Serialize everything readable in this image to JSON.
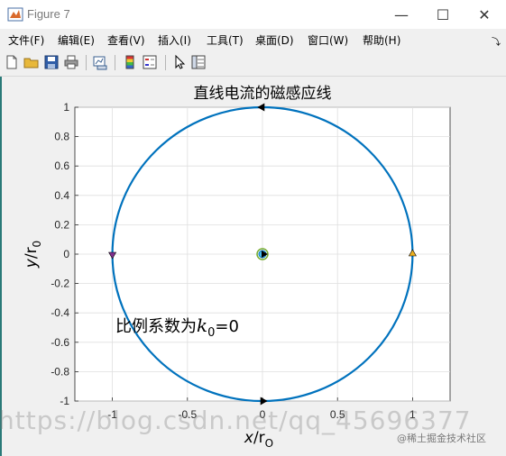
{
  "window": {
    "title": "Figure 7",
    "icon": "matlab-figure-icon",
    "controls": [
      "minimize-icon",
      "maximize-icon",
      "close-icon"
    ]
  },
  "menu": {
    "items": [
      {
        "label": "文件(F)"
      },
      {
        "label": "编辑(E)"
      },
      {
        "label": "查看(V)"
      },
      {
        "label": "插入(I)"
      },
      {
        "label": "工具(T)"
      },
      {
        "label": "桌面(D)"
      },
      {
        "label": "窗口(W)"
      },
      {
        "label": "帮助(H)"
      }
    ],
    "overflow_icon": "dock-arrow-icon"
  },
  "toolbar": {
    "buttons": [
      "new-figure-icon",
      "open-file-icon",
      "save-icon",
      "print-icon",
      "link-plot-icon",
      "colorbar-icon",
      "legend-icon",
      "pointer-icon",
      "property-editor-icon"
    ]
  },
  "chart_data": {
    "type": "line",
    "title": "直线电流的磁感应线",
    "xlabel": "x/r_O",
    "ylabel": "y/r_0",
    "xlim": [
      -1.25,
      1.25
    ],
    "ylim": [
      -1,
      1
    ],
    "xticks": [
      "-1",
      "-0.5",
      "0",
      "0.5",
      "1"
    ],
    "yticks": [
      "-1",
      "-0.8",
      "-0.6",
      "-0.4",
      "-0.2",
      "0",
      "0.2",
      "0.4",
      "0.6",
      "0.8",
      "1"
    ],
    "grid": true,
    "series": [
      {
        "shape": "circle",
        "center": [
          0,
          0
        ],
        "radius": 1,
        "color": "#0072bd"
      }
    ],
    "arrows": [
      {
        "x": 0,
        "y": 1,
        "direction": "left",
        "color": "#000000"
      },
      {
        "x": -1,
        "y": 0,
        "direction": "down",
        "color": "#7e2f8e"
      },
      {
        "x": 0,
        "y": -1,
        "direction": "right",
        "color": "#000000"
      },
      {
        "x": 1,
        "y": 0,
        "direction": "up",
        "color": "#edb120"
      }
    ],
    "center_marker": {
      "x": 0,
      "y": 0,
      "color": "#77ac30"
    },
    "annotation": {
      "text_prefix": "比例系数为",
      "k": "k",
      "sub": "0",
      "suffix": "=0",
      "x": -1,
      "y": -0.5
    }
  },
  "watermarks": {
    "url": "https://blog.csdn.net/qq_45696377",
    "brand": "@稀土掘金技术社区"
  }
}
